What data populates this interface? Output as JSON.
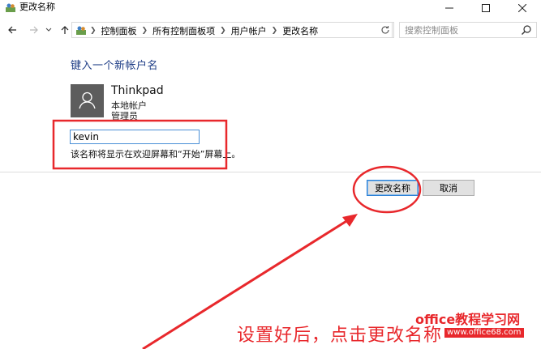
{
  "window": {
    "title": "更改名称",
    "controls": {
      "minimize_icon": "minimize-icon",
      "maximize_icon": "maximize-icon",
      "close_icon": "close-icon"
    }
  },
  "nav": {
    "back_icon": "arrow-left-icon",
    "forward_icon": "arrow-right-icon",
    "recent_icon": "chevron-down-icon",
    "up_icon": "arrow-up-icon"
  },
  "address_bar": {
    "breadcrumbs": [
      "控制面板",
      "所有控制面板项",
      "用户帐户",
      "更改名称"
    ],
    "refresh_icon": "refresh-icon"
  },
  "search": {
    "placeholder": "搜索控制面板",
    "icon": "search-icon"
  },
  "main": {
    "heading": "键入一个新帐户名",
    "account": {
      "name": "Thinkpad",
      "type": "本地帐户",
      "role": "管理员"
    },
    "name_input_value": "kevin",
    "hint": "该名称将显示在欢迎屏幕和“开始”屏幕上。",
    "buttons": {
      "rename": "更改名称",
      "cancel": "取消"
    }
  },
  "annotation": {
    "text": "设置好后，点击更改名称",
    "color": "#e8282c"
  },
  "watermark": {
    "text": "office教程学习网",
    "url": "www.office68.com"
  }
}
